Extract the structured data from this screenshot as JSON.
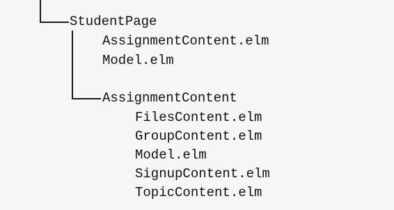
{
  "tree": {
    "root": {
      "label": "StudentPage",
      "files": [
        "AssignmentContent.elm",
        "Model.elm"
      ],
      "child": {
        "label": "AssignmentContent",
        "files": [
          "FilesContent.elm",
          "GroupContent.elm",
          "Model.elm",
          "SignupContent.elm",
          "TopicContent.elm"
        ]
      }
    }
  }
}
